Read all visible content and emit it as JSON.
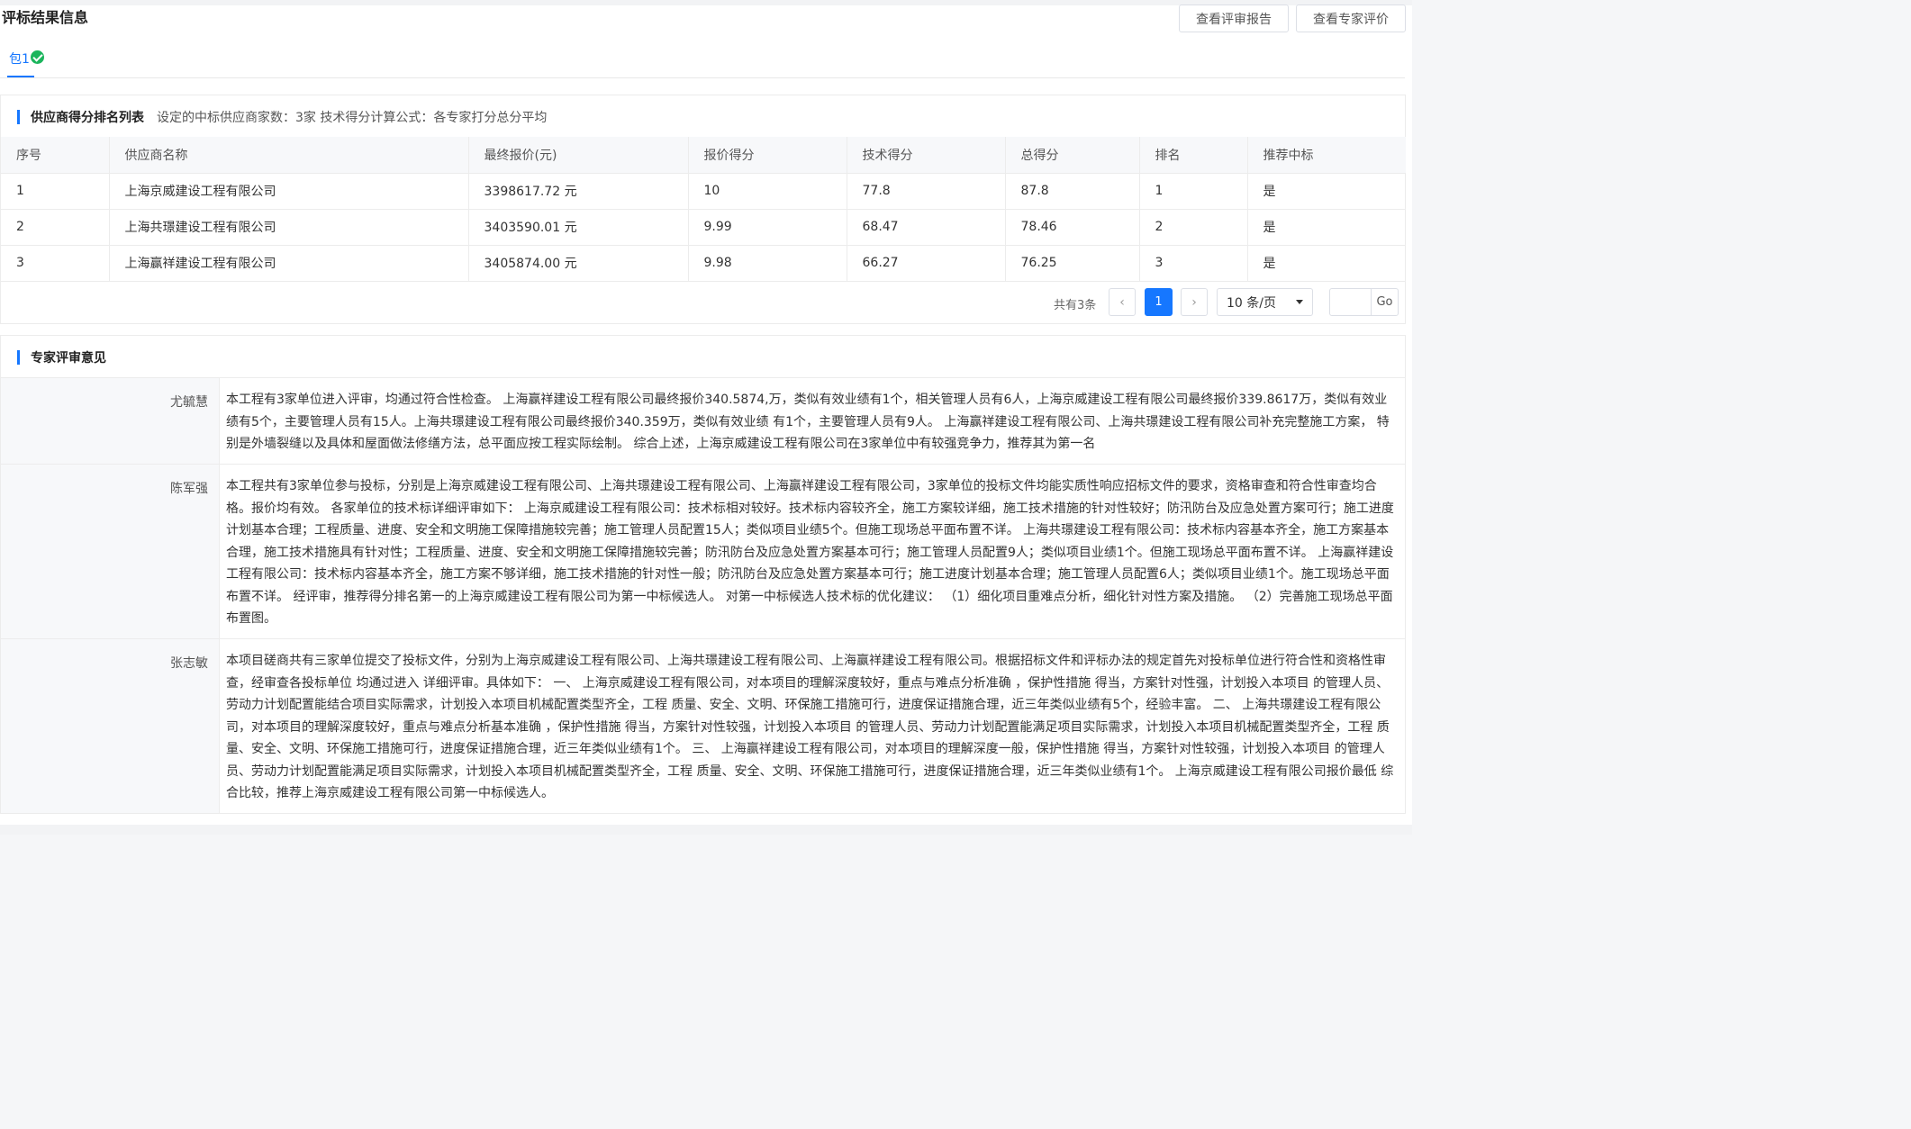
{
  "page": {
    "title": "评标结果信息",
    "buttons": {
      "report": "查看评审报告",
      "expert": "查看专家评价"
    },
    "tab": {
      "label": "包1",
      "status_icon": "check-circle-icon",
      "status_color": "#1bb55c"
    }
  },
  "colors": {
    "accent": "#1677ff",
    "border": "#ececec",
    "header_bg": "#f7f8fa"
  },
  "supplier": {
    "title": "供应商得分排名列表",
    "description": "设定的中标供应商家数：3家  技术得分计算公式：各专家打分总分平均",
    "columns": [
      "序号",
      "供应商名称",
      "最终报价(元)",
      "报价得分",
      "技术得分",
      "总得分",
      "排名",
      "推荐中标"
    ],
    "rows": [
      [
        "1",
        "上海京威建设工程有限公司",
        "3398617.72 元",
        "10",
        "77.8",
        "87.8",
        "1",
        "是"
      ],
      [
        "2",
        "上海共璟建设工程有限公司",
        "3403590.01 元",
        "9.99",
        "68.47",
        "78.46",
        "2",
        "是"
      ],
      [
        "3",
        "上海赢祥建设工程有限公司",
        "3405874.00 元",
        "9.98",
        "66.27",
        "76.25",
        "3",
        "是"
      ]
    ],
    "pagination": {
      "total_text": "共有3条",
      "prev_icon": "‹",
      "current_page": "1",
      "next_icon": "›",
      "page_size": "10 条/页",
      "jump_value": "",
      "go_label": "Go"
    }
  },
  "experts": {
    "title": "专家评审意见",
    "items": [
      {
        "name": "尤毓慧",
        "text": "本工程有3家单位进入评审，均通过符合性检查。 上海赢祥建设工程有限公司最终报价340.5874,万，类似有效业绩有1个，相关管理人员有6人，上海京威建设工程有限公司最终报价339.8617万，类似有效业绩有5个，主要管理人员有15人。上海共璟建设工程有限公司最终报价340.359万，类似有效业绩 有1个，主要管理人员有9人。 上海赢祥建设工程有限公司、上海共璟建设工程有限公司补充完整施工方案， 特别是外墙裂缝以及具体和屋面做法修缮方法，总平面应按工程实际绘制。 综合上述，上海京威建设工程有限公司在3家单位中有较强竞争力，推荐其为第一名"
      },
      {
        "name": "陈军强",
        "text": "本工程共有3家单位参与投标，分别是上海京威建设工程有限公司、上海共璟建设工程有限公司、上海赢祥建设工程有限公司，3家单位的投标文件均能实质性响应招标文件的要求，资格审查和符合性审查均合格。报价均有效。 各家单位的技术标详细评审如下： 上海京威建设工程有限公司：技术标相对较好。技术标内容较齐全，施工方案较详细，施工技术措施的针对性较好；防汛防台及应急处置方案可行；施工进度计划基本合理；工程质量、进度、安全和文明施工保障措施较完善；施工管理人员配置15人；类似项目业绩5个。但施工现场总平面布置不详。 上海共璟建设工程有限公司：技术标内容基本齐全，施工方案基本合理，施工技术措施具有针对性；工程质量、进度、安全和文明施工保障措施较完善；防汛防台及应急处置方案基本可行；施工管理人员配置9人；类似项目业绩1个。但施工现场总平面布置不详。 上海赢祥建设工程有限公司：技术标内容基本齐全，施工方案不够详细，施工技术措施的针对性一般；防汛防台及应急处置方案基本可行；施工进度计划基本合理；施工管理人员配置6人；类似项目业绩1个。施工现场总平面布置不详。 经评审，推荐得分排名第一的上海京威建设工程有限公司为第一中标候选人。 对第一中标候选人技术标的优化建议：  （1）细化项目重难点分析，细化针对性方案及措施。  （2）完善施工现场总平面布置图。"
      },
      {
        "name": "张志敏",
        "text": "本项目磋商共有三家单位提交了投标文件，分别为上海京威建设工程有限公司、上海共璟建设工程有限公司、上海赢祥建设工程有限公司。根据招标文件和评标办法的规定首先对投标单位进行符合性和资格性审查，经审查各投标单位 均通过进入 详细评审。具体如下： 一、 上海京威建设工程有限公司，对本项目的理解深度较好，重点与难点分析准确 ，保护性措施 得当，方案针对性强，计划投入本项目 的管理人员、劳动力计划配置能结合项目实际需求，计划投入本项目机械配置类型齐全，工程 质量、安全、文明、环保施工措施可行，进度保证措施合理，近三年类似业绩有5个，经验丰富。 二、 上海共璟建设工程有限公司，对本项目的理解深度较好，重点与难点分析基本准确 ，保护性措施 得当，方案针对性较强，计划投入本项目 的管理人员、劳动力计划配置能满足项目实际需求，计划投入本项目机械配置类型齐全，工程 质量、安全、文明、环保施工措施可行，进度保证措施合理，近三年类似业绩有1个。 三、 上海赢祥建设工程有限公司，对本项目的理解深度一般，保护性措施 得当，方案针对性较强，计划投入本项目 的管理人员、劳动力计划配置能满足项目实际需求，计划投入本项目机械配置类型齐全，工程 质量、安全、文明、环保施工措施可行，进度保证措施合理，近三年类似业绩有1个。 上海京威建设工程有限公司报价最低 综合比较，推荐上海京威建设工程有限公司第一中标候选人。"
      }
    ]
  }
}
